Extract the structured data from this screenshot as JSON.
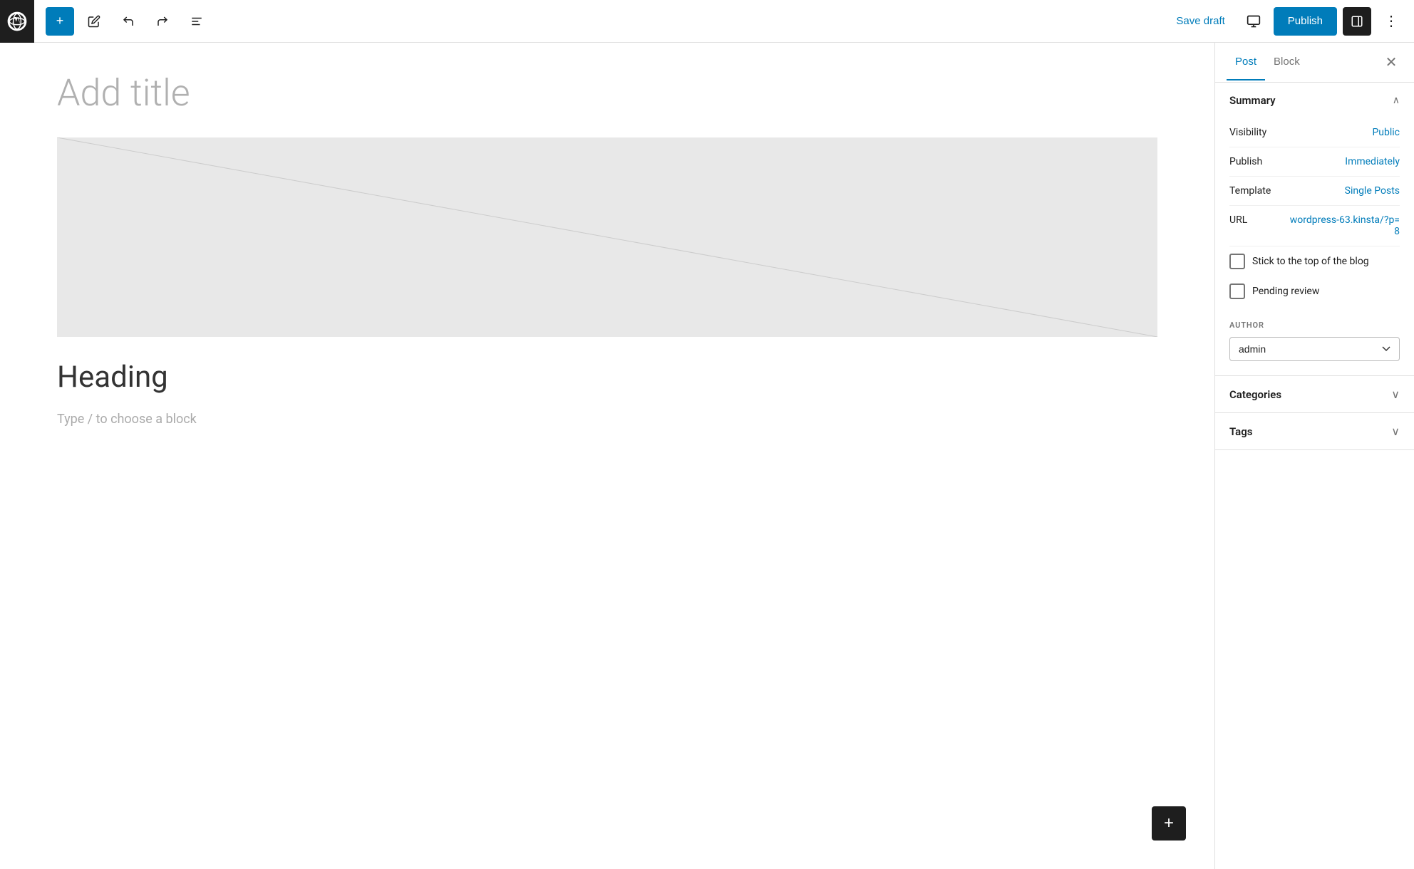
{
  "topbar": {
    "add_label": "+",
    "save_draft_label": "Save draft",
    "publish_label": "Publish"
  },
  "editor": {
    "title_placeholder": "Add title",
    "heading_text": "Heading",
    "paragraph_placeholder": "Type / to choose a block"
  },
  "sidebar": {
    "tab_post": "Post",
    "tab_block": "Block",
    "summary_title": "Summary",
    "visibility_label": "Visibility",
    "visibility_value": "Public",
    "publish_label": "Publish",
    "publish_value": "Immediately",
    "template_label": "Template",
    "template_value": "Single Posts",
    "url_label": "URL",
    "url_value": "wordpress-63.kinsta/?p=8",
    "stick_top_label": "Stick to the top of the blog",
    "pending_review_label": "Pending review",
    "author_section_label": "AUTHOR",
    "author_value": "admin",
    "author_options": [
      "admin"
    ],
    "categories_title": "Categories",
    "tags_title": "Tags"
  }
}
